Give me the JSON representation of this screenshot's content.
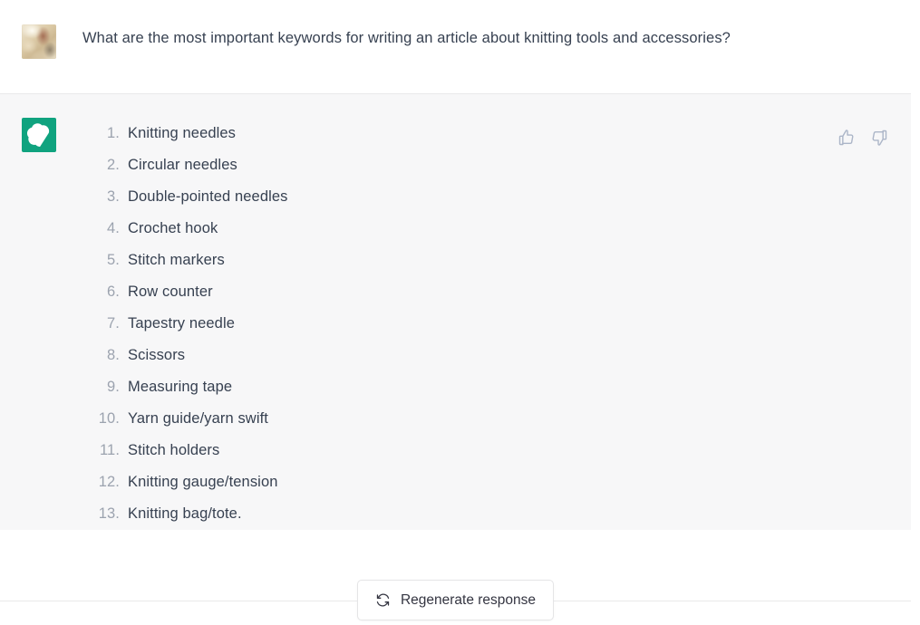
{
  "theme": {
    "user_bg": "#ffffff",
    "assistant_bg": "#f7f7f8",
    "divider": "#e9e9ea",
    "text": "#374151",
    "muted_text": "#9ca3af",
    "brand_green": "#10a37f",
    "icon_blue_gray": "#acb6c8"
  },
  "conversation": {
    "user_message": {
      "avatar_name": "user-avatar-photo",
      "text": "What are the most important keywords for writing an article about knitting tools and accessories?"
    },
    "assistant_message": {
      "avatar_name": "chatgpt-logo-icon",
      "list_items": [
        {
          "number": "1.",
          "text": "Knitting needles"
        },
        {
          "number": "2.",
          "text": "Circular needles"
        },
        {
          "number": "3.",
          "text": "Double-pointed needles"
        },
        {
          "number": "4.",
          "text": "Crochet hook"
        },
        {
          "number": "5.",
          "text": "Stitch markers"
        },
        {
          "number": "6.",
          "text": "Row counter"
        },
        {
          "number": "7.",
          "text": "Tapestry needle"
        },
        {
          "number": "8.",
          "text": "Scissors"
        },
        {
          "number": "9.",
          "text": "Measuring tape"
        },
        {
          "number": "10.",
          "text": "Yarn guide/yarn swift"
        },
        {
          "number": "11.",
          "text": "Stitch holders"
        },
        {
          "number": "12.",
          "text": "Knitting gauge/tension"
        },
        {
          "number": "13.",
          "text": "Knitting bag/tote."
        }
      ],
      "feedback": {
        "thumbs_up_name": "thumbs-up-icon",
        "thumbs_down_name": "thumbs-down-icon"
      }
    }
  },
  "bottom_bar": {
    "regenerate": {
      "label": "Regenerate response",
      "icon_name": "refresh-icon"
    }
  }
}
